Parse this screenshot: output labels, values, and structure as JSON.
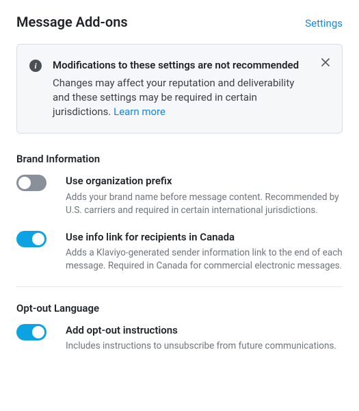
{
  "header": {
    "title": "Message Add-ons",
    "settings_link": "Settings"
  },
  "alert": {
    "title": "Modifications to these settings are not recommended",
    "description": "Changes may affect your reputation and deliverability and these settings may be required in certain jurisdictions. ",
    "learn_more": "Learn more"
  },
  "sections": {
    "brand": {
      "title": "Brand Information",
      "items": [
        {
          "enabled": false,
          "label": "Use organization prefix",
          "desc": "Adds your brand name before message content. Recommended by U.S. carriers and required in certain international jurisdictions."
        },
        {
          "enabled": true,
          "label": "Use info link for recipients in Canada",
          "desc": "Adds a Klaviyo-generated sender information link to the end of each message. Required in Canada for commercial electronic messages."
        }
      ]
    },
    "optout": {
      "title": "Opt-out Language",
      "items": [
        {
          "enabled": true,
          "label": "Add opt-out instructions",
          "desc": "Includes instructions to unsubscribe from future communications."
        }
      ]
    }
  }
}
